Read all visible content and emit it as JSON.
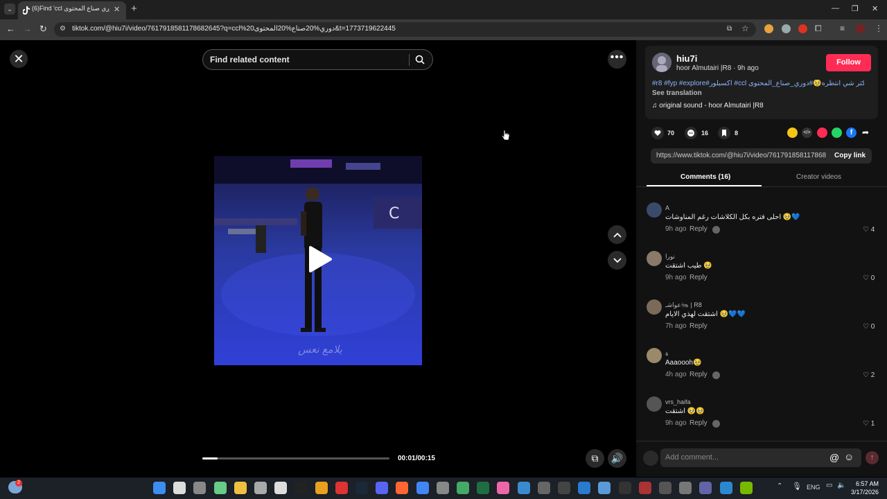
{
  "browser": {
    "tab_title": "(6)Find 'ccl دوري صناع المحتوى'",
    "url": "tiktok.com/@hiu7i/video/7617918581178682645?q=ccl%20دوري%20صناع%20المحتوى&t=1773719622445"
  },
  "search": {
    "placeholder": "Find related content"
  },
  "video": {
    "watermark": "يلامع نعس",
    "time": "00:01/00:15",
    "progress": 0.08
  },
  "author": {
    "username": "hiu7i",
    "subline": "hoor Almutairi |R8 · 9h ago",
    "follow_label": "Follow",
    "caption": "#r8 #fyp #explore#اكسبلور #ccl اكثر شي انتظره🥹#دوري_صناع_المحتوى",
    "see_translation": "See translation",
    "music": "original sound - hoor Almutairi |R8"
  },
  "stats": {
    "likes": "70",
    "comments": "16",
    "saves": "8"
  },
  "share_link": {
    "url": "https://www.tiktok.com/@hiu7i/video/761791858117868...",
    "copy_label": "Copy link"
  },
  "tabs": {
    "comments": "Comments (16)",
    "creator": "Creator videos"
  },
  "comments": [
    {
      "name": "A",
      "text": "احلى فتره بكل الكلاشات رغم المناوشات 🥹💙",
      "time": "9h ago",
      "reply": "Reply",
      "likes": "4",
      "creator_liked": true
    },
    {
      "name": "نورا",
      "text": "طيب اشتقت 🥹",
      "time": "9h ago",
      "reply": "Reply",
      "likes": "0",
      "creator_liked": false
    },
    {
      "name": "عواشـ🐜 | R8",
      "text": "اشتقت لهذي الايام 🥹💙💙",
      "time": "7h ago",
      "reply": "Reply",
      "likes": "0",
      "creator_liked": false
    },
    {
      "name": "ة",
      "text": "Aaaoooh🥹",
      "time": "4h ago",
      "reply": "Reply",
      "likes": "2",
      "creator_liked": true
    },
    {
      "name": "vrs_haifa",
      "text": "اشتقت 🥹🥹",
      "time": "9h ago",
      "reply": "Reply",
      "likes": "1",
      "creator_liked": true
    }
  ],
  "comment_input": {
    "placeholder": "Add comment..."
  },
  "taskbar": {
    "lang": "ENG",
    "time": "6:57 AM",
    "date": "3/17/2026",
    "badge": "2"
  },
  "colors": {
    "accent": "#fe2c55",
    "hashtag": "#8ab4f8",
    "panel": "#121212"
  }
}
